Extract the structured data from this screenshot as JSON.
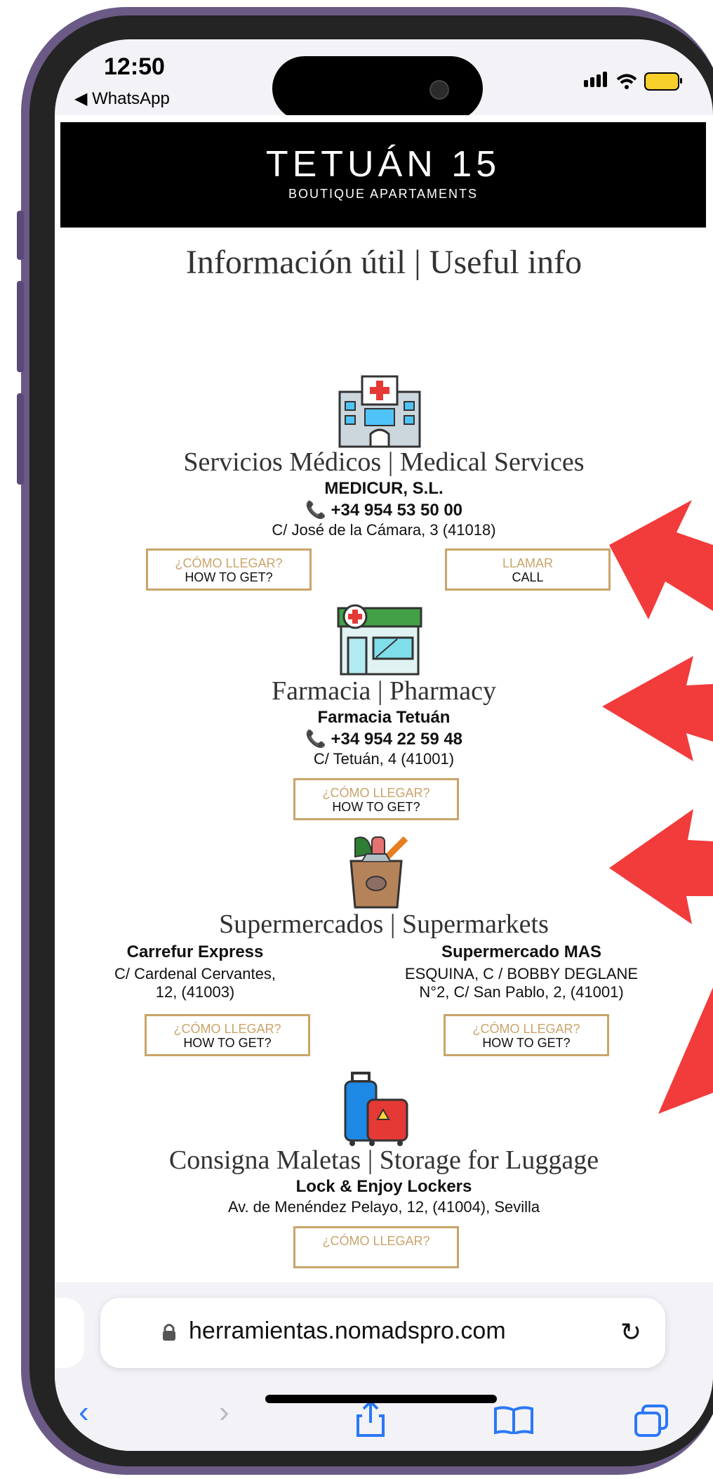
{
  "status": {
    "time": "12:50",
    "back_app": "◀ WhatsApp"
  },
  "banner": {
    "brand": "TETUÁN 15",
    "subtitle": "BOUTIQUE APARTAMENTS"
  },
  "page_title": "Información útil | Useful info",
  "sections": {
    "medical": {
      "title": "Servicios Médicos | Medical Services",
      "name": "MEDICUR, S.L.",
      "phone": "📞 +34 954 53 50 00",
      "address": "C/ José de la Cámara, 3 (41018)",
      "btn_directions_es": "¿CÓMO LLEGAR?",
      "btn_directions_en": "HOW TO GET?",
      "btn_call_es": "LLAMAR",
      "btn_call_en": "CALL"
    },
    "pharmacy": {
      "title": "Farmacia | Pharmacy",
      "name": "Farmacia Tetuán",
      "phone": "📞 +34 954 22 59 48",
      "address": "C/ Tetuán, 4 (41001)",
      "btn_directions_es": "¿CÓMO LLEGAR?",
      "btn_directions_en": "HOW TO GET?"
    },
    "supermarkets": {
      "title": "Supermercados | Supermarkets",
      "left": {
        "name": "Carrefur Express",
        "address1": "C/ Cardenal Cervantes,",
        "address2": "12, (41003)",
        "btn_es": "¿CÓMO LLEGAR?",
        "btn_en": "HOW TO GET?"
      },
      "right": {
        "name": "Supermercado MAS",
        "address1": "ESQUINA, C / BOBBY DEGLANE",
        "address2": "N°2, C/ San Pablo, 2, (41001)",
        "btn_es": "¿CÓMO LLEGAR?",
        "btn_en": "HOW TO GET?"
      }
    },
    "luggage": {
      "title": "Consigna Maletas | Storage for Luggage",
      "name": "Lock & Enjoy Lockers",
      "address": "Av. de Menéndez Pelayo, 12, (41004), Sevilla",
      "btn_directions_es": "¿CÓMO LLEGAR?"
    }
  },
  "browser": {
    "url": "herramientas.nomadspro.com"
  },
  "colors": {
    "accent_gold": "#c9a46a",
    "ios_blue": "#2a78f6",
    "arrow_red": "#f23b3b",
    "frame_purple": "#6b5a86"
  }
}
